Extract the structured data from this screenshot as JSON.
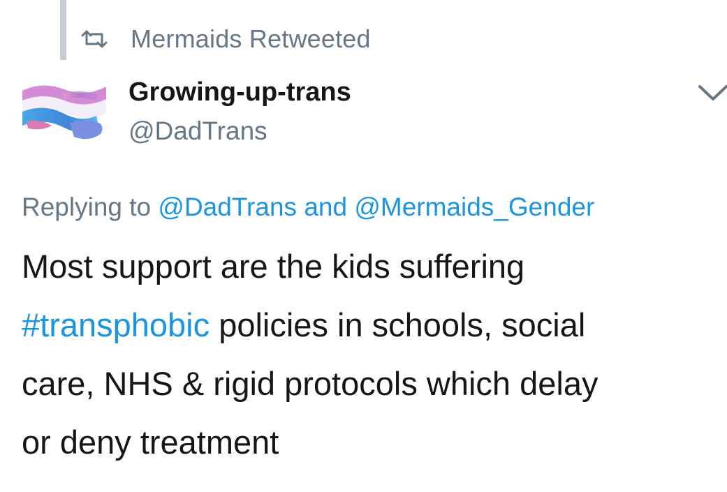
{
  "retweet_header": {
    "text": "Mermaids Retweeted",
    "icon": "retweet-icon"
  },
  "author": {
    "display_name": "Growing-up-trans",
    "handle": "@DadTrans",
    "avatar": "trans-flag-wave-avatar"
  },
  "menu": {
    "icon": "chevron-down-icon"
  },
  "reply": {
    "prefix": "Replying to",
    "mention_1": "@DadTrans",
    "conjunction": "and",
    "mention_2": "@Mermaids_Gender"
  },
  "tweet": {
    "line_1": "Most support are the kids suffering",
    "hashtag": "#transphobic",
    "line_2_rest": " policies in schools, social",
    "line_3": "care, NHS & rigid protocols which delay",
    "line_4": "or deny treatment"
  },
  "colors": {
    "link": "#1b95e0",
    "secondary_text": "#657786",
    "primary_text": "#14171a",
    "thread_line": "#c5ccd3",
    "flag_blue": "#5bcefa",
    "flag_pink": "#f5a9b8"
  }
}
